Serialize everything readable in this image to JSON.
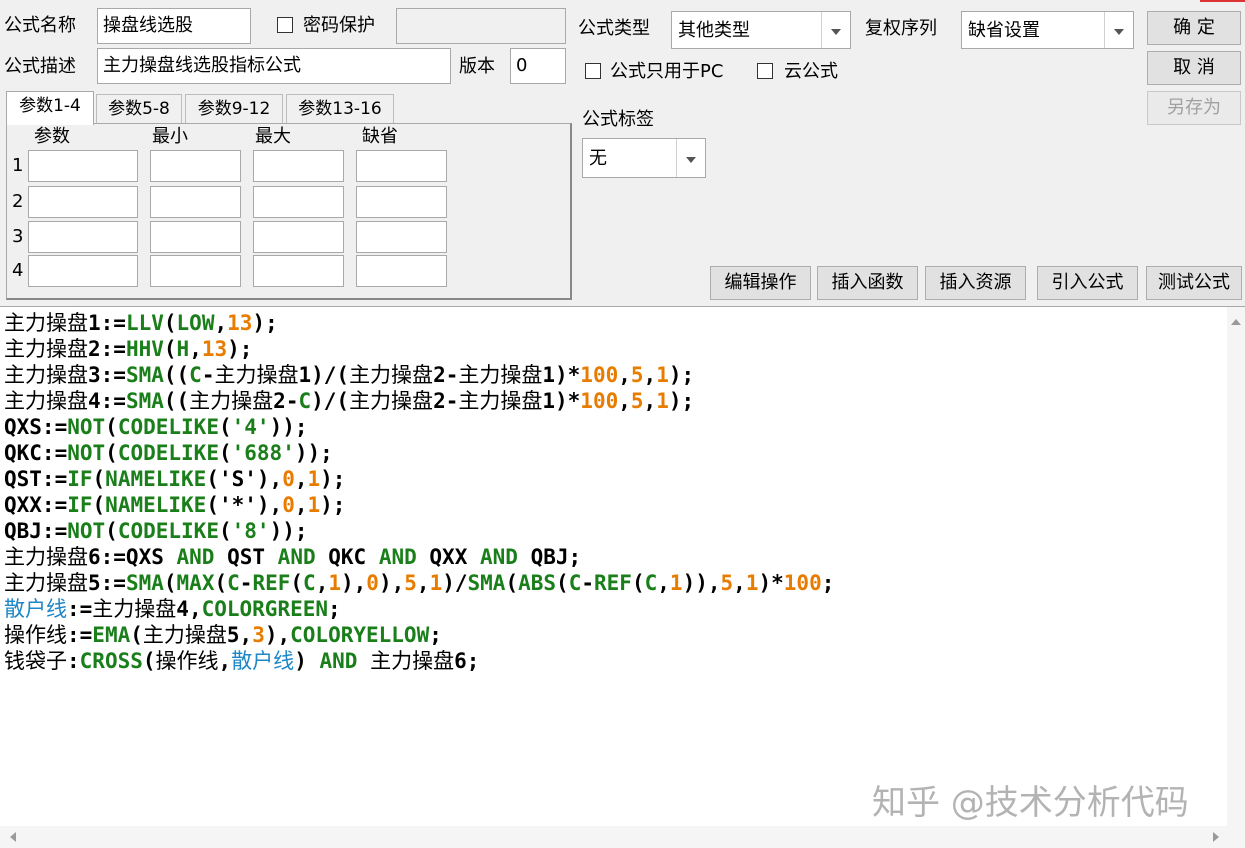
{
  "header": {
    "name_label": "公式名称",
    "name_value": "操盘线选股",
    "password_label": "密码保护",
    "desc_label": "公式描述",
    "desc_value": "主力操盘线选股指标公式",
    "version_label": "版本",
    "version_value": "0",
    "type_label": "公式类型",
    "type_value": "其他类型",
    "rights_label": "复权序列",
    "rights_value": "缺省设置",
    "pc_only_label": "公式只用于PC",
    "cloud_label": "云公式",
    "tag_label": "公式标签",
    "tag_value": "无"
  },
  "buttons": {
    "ok": "确  定",
    "cancel": "取  消",
    "save_as": "另存为",
    "edit_ops": "编辑操作",
    "insert_func": "插入函数",
    "insert_res": "插入资源",
    "import_formula": "引入公式",
    "test_formula": "测试公式"
  },
  "params": {
    "tabs": [
      "参数1-4",
      "参数5-8",
      "参数9-12",
      "参数13-16"
    ],
    "active_tab": 0,
    "columns": [
      "参数",
      "最小",
      "最大",
      "缺省"
    ],
    "rows": [
      "1",
      "2",
      "3",
      "4"
    ]
  },
  "code": {
    "lines": [
      [
        [
          "n",
          "主力操盘1:="
        ],
        [
          "f",
          "LLV"
        ],
        [
          "n",
          "("
        ],
        [
          "f",
          "LOW"
        ],
        [
          "n",
          ","
        ],
        [
          "num",
          "13"
        ],
        [
          "n",
          ");"
        ]
      ],
      [
        [
          "n",
          "主力操盘2:="
        ],
        [
          "f",
          "HHV"
        ],
        [
          "n",
          "("
        ],
        [
          "f",
          "H"
        ],
        [
          "n",
          ","
        ],
        [
          "num",
          "13"
        ],
        [
          "n",
          ");"
        ]
      ],
      [
        [
          "n",
          "主力操盘3:="
        ],
        [
          "f",
          "SMA"
        ],
        [
          "n",
          "(("
        ],
        [
          "f",
          "C"
        ],
        [
          "n",
          "-主力操盘1)/(主力操盘2-主力操盘1)*"
        ],
        [
          "num",
          "100"
        ],
        [
          "n",
          ","
        ],
        [
          "num",
          "5"
        ],
        [
          "n",
          ","
        ],
        [
          "num",
          "1"
        ],
        [
          "n",
          ");"
        ]
      ],
      [
        [
          "n",
          "主力操盘4:="
        ],
        [
          "f",
          "SMA"
        ],
        [
          "n",
          "((主力操盘2-"
        ],
        [
          "f",
          "C"
        ],
        [
          "n",
          ")/(主力操盘2-主力操盘1)*"
        ],
        [
          "num",
          "100"
        ],
        [
          "n",
          ","
        ],
        [
          "num",
          "5"
        ],
        [
          "n",
          ","
        ],
        [
          "num",
          "1"
        ],
        [
          "n",
          ");"
        ]
      ],
      [
        [
          "n",
          "QXS:="
        ],
        [
          "f",
          "NOT"
        ],
        [
          "n",
          "("
        ],
        [
          "f",
          "CODELIKE"
        ],
        [
          "n",
          "("
        ],
        [
          "s",
          "'4'"
        ],
        [
          "n",
          "));"
        ]
      ],
      [
        [
          "n",
          "QKC:="
        ],
        [
          "f",
          "NOT"
        ],
        [
          "n",
          "("
        ],
        [
          "f",
          "CODELIKE"
        ],
        [
          "n",
          "("
        ],
        [
          "s",
          "'688'"
        ],
        [
          "n",
          "));"
        ]
      ],
      [
        [
          "n",
          "QST:="
        ],
        [
          "f",
          "IF"
        ],
        [
          "n",
          "("
        ],
        [
          "f",
          "NAMELIKE"
        ],
        [
          "n",
          "('S'),"
        ],
        [
          "num",
          "0"
        ],
        [
          "n",
          ","
        ],
        [
          "num",
          "1"
        ],
        [
          "n",
          ");"
        ]
      ],
      [
        [
          "n",
          "QXX:="
        ],
        [
          "f",
          "IF"
        ],
        [
          "n",
          "("
        ],
        [
          "f",
          "NAMELIKE"
        ],
        [
          "n",
          "('*'),"
        ],
        [
          "num",
          "0"
        ],
        [
          "n",
          ","
        ],
        [
          "num",
          "1"
        ],
        [
          "n",
          ");"
        ]
      ],
      [
        [
          "n",
          "QBJ:="
        ],
        [
          "f",
          "NOT"
        ],
        [
          "n",
          "("
        ],
        [
          "f",
          "CODELIKE"
        ],
        [
          "n",
          "("
        ],
        [
          "s",
          "'8'"
        ],
        [
          "n",
          "));"
        ]
      ],
      [
        [
          "n",
          "主力操盘6:=QXS "
        ],
        [
          "f",
          "AND"
        ],
        [
          "n",
          " QST "
        ],
        [
          "f",
          "AND"
        ],
        [
          "n",
          " QKC "
        ],
        [
          "f",
          "AND"
        ],
        [
          "n",
          " QXX "
        ],
        [
          "f",
          "AND"
        ],
        [
          "n",
          " QBJ;"
        ]
      ],
      [
        [
          "n",
          "主力操盘5:="
        ],
        [
          "f",
          "SMA"
        ],
        [
          "n",
          "("
        ],
        [
          "f",
          "MAX"
        ],
        [
          "n",
          "("
        ],
        [
          "f",
          "C"
        ],
        [
          "n",
          "-"
        ],
        [
          "f",
          "REF"
        ],
        [
          "n",
          "("
        ],
        [
          "f",
          "C"
        ],
        [
          "n",
          ","
        ],
        [
          "num",
          "1"
        ],
        [
          "n",
          "),"
        ],
        [
          "num",
          "0"
        ],
        [
          "n",
          "),"
        ],
        [
          "num",
          "5"
        ],
        [
          "n",
          ","
        ],
        [
          "num",
          "1"
        ],
        [
          "n",
          ")/"
        ],
        [
          "f",
          "SMA"
        ],
        [
          "n",
          "("
        ],
        [
          "f",
          "ABS"
        ],
        [
          "n",
          "("
        ],
        [
          "f",
          "C"
        ],
        [
          "n",
          "-"
        ],
        [
          "f",
          "REF"
        ],
        [
          "n",
          "("
        ],
        [
          "f",
          "C"
        ],
        [
          "n",
          ","
        ],
        [
          "num",
          "1"
        ],
        [
          "n",
          ")),"
        ],
        [
          "num",
          "5"
        ],
        [
          "n",
          ","
        ],
        [
          "num",
          "1"
        ],
        [
          "n",
          ")*"
        ],
        [
          "num",
          "100"
        ],
        [
          "n",
          ";"
        ]
      ],
      [
        [
          "var",
          "散户线"
        ],
        [
          "n",
          ":=主力操盘4,"
        ],
        [
          "f",
          "COLORGREEN"
        ],
        [
          "n",
          ";"
        ]
      ],
      [
        [
          "n",
          "操作线:="
        ],
        [
          "f",
          "EMA"
        ],
        [
          "n",
          "(主力操盘5,"
        ],
        [
          "num",
          "3"
        ],
        [
          "n",
          "),"
        ],
        [
          "f",
          "COLORYELLOW"
        ],
        [
          "n",
          ";"
        ]
      ],
      [
        [
          "n",
          "钱袋子:"
        ],
        [
          "f",
          "CROSS"
        ],
        [
          "n",
          "(操作线,"
        ],
        [
          "var",
          "散户线"
        ],
        [
          "n",
          ") "
        ],
        [
          "f",
          "AND"
        ],
        [
          "n",
          " 主力操盘6;"
        ]
      ]
    ]
  },
  "watermark": "知乎 @技术分析代码",
  "colors": {
    "func": "#1a7f1a",
    "number": "#e87c00",
    "variable": "#1e87c7"
  }
}
